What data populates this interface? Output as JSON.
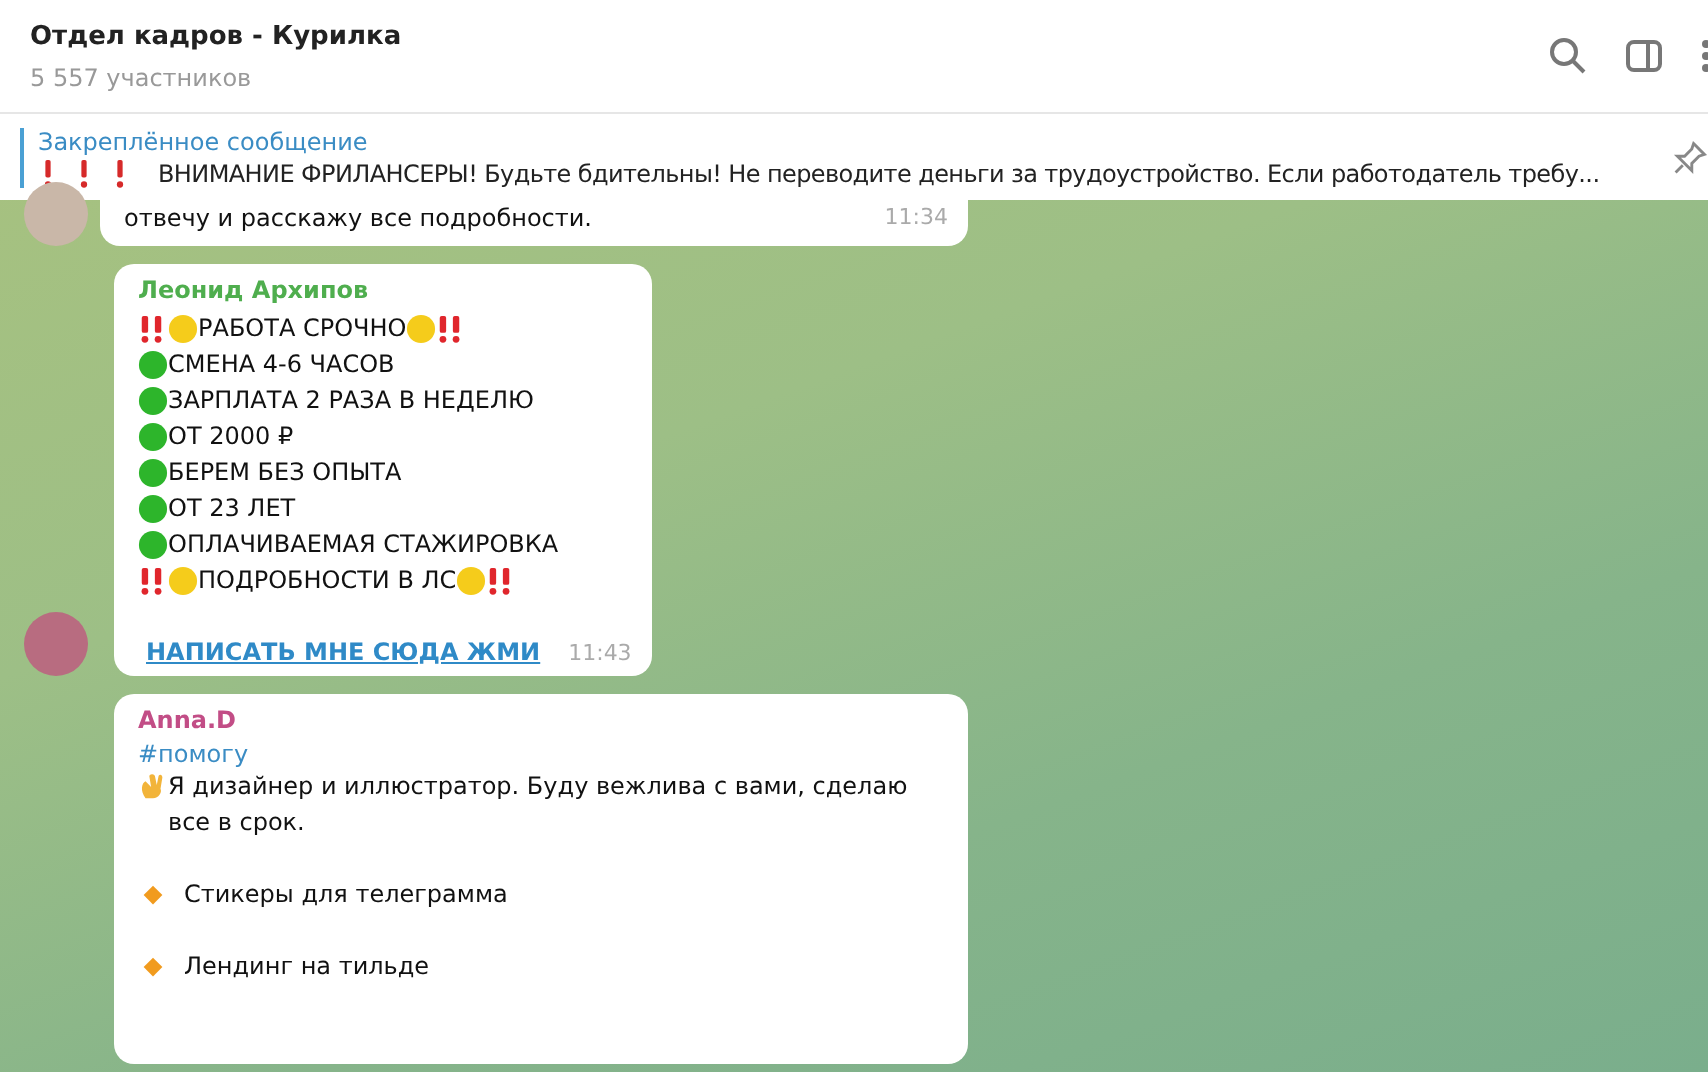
{
  "header": {
    "title": "Отдел кадров - Курилка",
    "subtitle": "5 557 участников"
  },
  "pinned": {
    "label": "Закреплённое сообщение",
    "text": "ВНИМАНИЕ ФРИЛАНСЕРЫ! Будьте бдительны! Не переводите деньги за трудоустройство. Если работодатель требу..."
  },
  "messages": [
    {
      "kind": "tail",
      "lines": [
        {
          "kind": "plain",
          "text": "отвечу и расскажу все подробности."
        }
      ],
      "time": "11:34",
      "avatar": true
    },
    {
      "kind": "full",
      "author": "Леонид Архипов",
      "color": "#4fae4e",
      "lines": [
        {
          "kind": "alert",
          "text": "РАБОТА СРОЧНО"
        },
        {
          "kind": "bullet",
          "text": "СМЕНА 4-6 ЧАСОВ"
        },
        {
          "kind": "bullet",
          "text": "ЗАРПЛАТА 2 РАЗА В НЕДЕЛЮ"
        },
        {
          "kind": "bullet",
          "text": "ОТ 2000 ₽"
        },
        {
          "kind": "bullet",
          "text": "БЕРЕМ БЕЗ ОПЫТА"
        },
        {
          "kind": "bullet",
          "text": "ОТ 23 ЛЕТ"
        },
        {
          "kind": "bullet",
          "text": "ОПЛАЧИВАЕМАЯ СТАЖИРОВКА"
        },
        {
          "kind": "alert",
          "text": "ПОДРОБНОСТИ В ЛС"
        }
      ],
      "link": "НАПИСАТЬ МНЕ СЮДА ЖМИ",
      "time": "11:43",
      "avatar": true
    },
    {
      "kind": "full",
      "author": "Anna.D",
      "color": "#c24d86",
      "hashtag": "#помогу",
      "lines": [
        {
          "kind": "wave",
          "text": "Я дизайнер и иллюстратор. Буду вежлива с вами, сделаю все в срок."
        },
        {
          "kind": "item",
          "text": "Стикеры для телеграмма"
        },
        {
          "kind": "item",
          "text": "Лендинг на тильде"
        }
      ],
      "avatar": false
    }
  ]
}
